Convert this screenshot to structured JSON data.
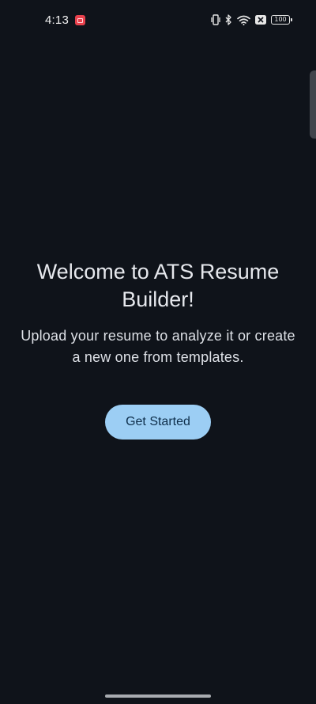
{
  "status_bar": {
    "time": "4:13",
    "battery_level": "100",
    "icons": [
      "app-notification-icon",
      "vibrate-icon",
      "bluetooth-icon",
      "wifi-icon",
      "no-sim-icon",
      "battery-icon"
    ]
  },
  "welcome": {
    "title": "Welcome to ATS Resume Builder!",
    "subtitle": "Upload your resume to analyze it or create a new one from templates."
  },
  "actions": {
    "get_started_label": "Get Started"
  },
  "colors": {
    "background": "#0f131a",
    "button_background": "#9ccef4",
    "button_text": "#0e2e4a",
    "text": "#e6e8ed"
  }
}
